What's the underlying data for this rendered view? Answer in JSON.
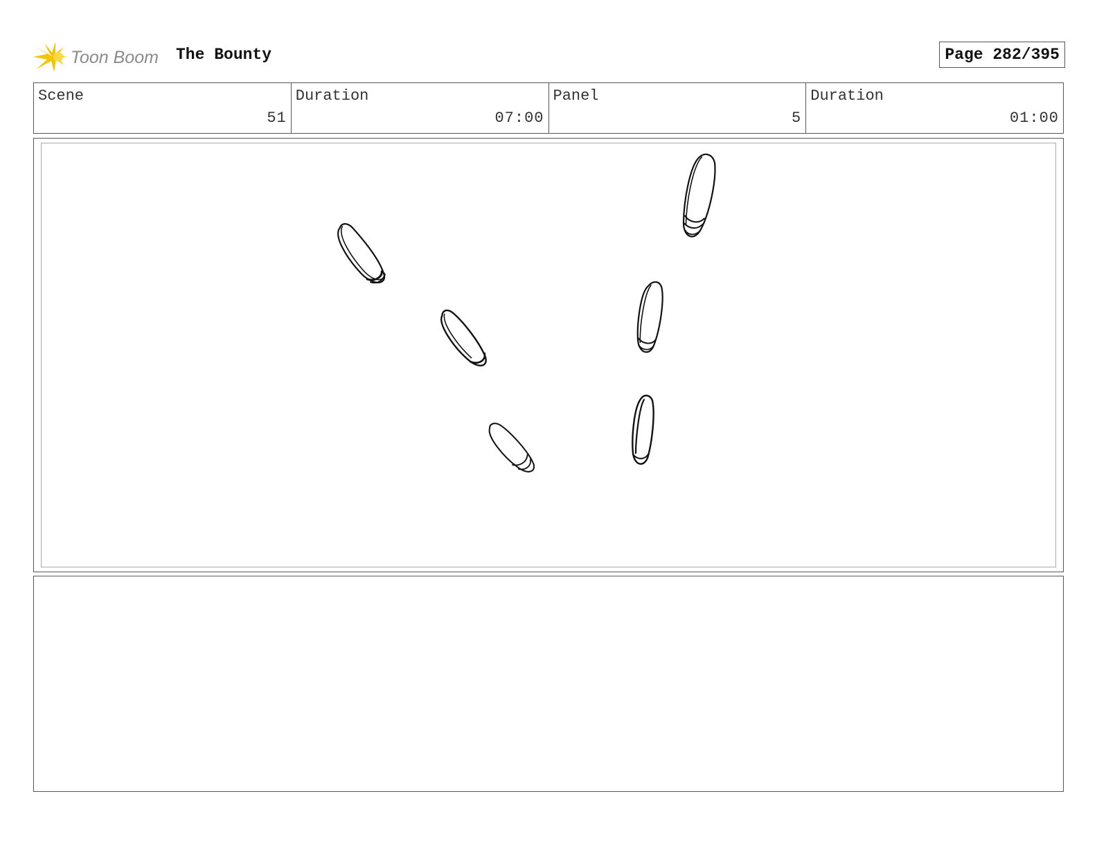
{
  "header": {
    "logo_text": "Toon Boom",
    "project_title": "The Bounty",
    "page_label": "Page 282/395"
  },
  "info": {
    "scene_label": "Scene",
    "scene_value": "51",
    "scene_duration_label": "Duration",
    "scene_duration_value": "07:00",
    "panel_label": "Panel",
    "panel_value": "5",
    "panel_duration_label": "Duration",
    "panel_duration_value": "01:00"
  },
  "colors": {
    "logo_yellow": "#F5C400",
    "logo_gray": "#8a8a8a",
    "border": "#555555",
    "sketch_ink": "#111111"
  },
  "panel": {
    "sketch_description_icon": "rowboats-sketch-icon"
  }
}
